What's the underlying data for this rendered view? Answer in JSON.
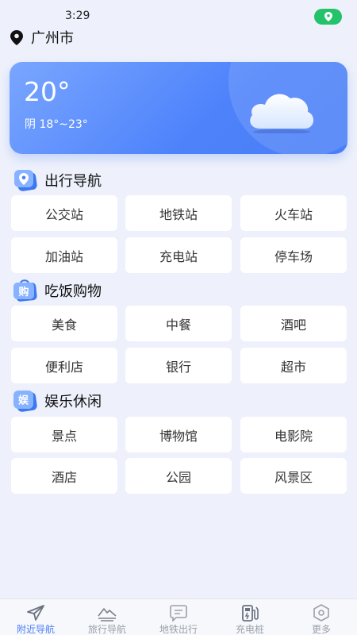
{
  "status": {
    "time": "3:29"
  },
  "location": {
    "city": "广州市"
  },
  "weather": {
    "temperature": "20°",
    "description": "阴 18°~23°"
  },
  "sections": [
    {
      "title": "出行导航",
      "icon": "map-pin-badge-icon",
      "items": [
        "公交站",
        "地铁站",
        "火车站",
        "加油站",
        "充电站",
        "停车场"
      ]
    },
    {
      "title": "吃饭购物",
      "icon": "shopping-bag-icon",
      "badge_char": "购",
      "items": [
        "美食",
        "中餐",
        "酒吧",
        "便利店",
        "银行",
        "超市"
      ]
    },
    {
      "title": "娱乐休闲",
      "icon": "entertainment-badge-icon",
      "badge_char": "娱",
      "items": [
        "景点",
        "博物馆",
        "电影院",
        "酒店",
        "公园",
        "风景区"
      ]
    }
  ],
  "bottom_nav": [
    {
      "label": "附近导航",
      "icon": "paper-plane-icon",
      "active": true
    },
    {
      "label": "旅行导航",
      "icon": "mountain-icon",
      "active": false
    },
    {
      "label": "地铁出行",
      "icon": "message-box-icon",
      "active": false
    },
    {
      "label": "充电桩",
      "icon": "charging-pile-icon",
      "active": false
    },
    {
      "label": "更多",
      "icon": "hexagon-icon",
      "active": false
    }
  ],
  "colors": {
    "accent": "#4a7ef6",
    "pill_green": "#23c26b",
    "background": "#eef1fb"
  }
}
